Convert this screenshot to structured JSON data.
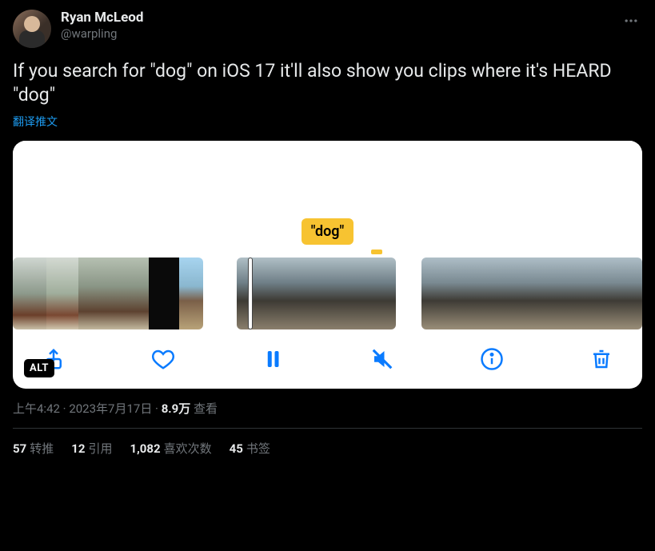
{
  "author": {
    "display_name": "Ryan McLeod",
    "handle": "@warpling"
  },
  "tweet_text": "If you search for \"dog\" on iOS 17 it'll also show you clips where it's HEARD \"dog\"",
  "translate_label": "翻译推文",
  "media": {
    "search_token": "\"dog\"",
    "alt_badge": "ALT",
    "toolbar": {
      "share": "share-icon",
      "like": "heart-icon",
      "pause": "pause-icon",
      "mute": "mute-icon",
      "info": "info-icon",
      "trash": "trash-icon"
    }
  },
  "meta": {
    "time": "上午4:42",
    "date": "2023年7月17日",
    "views_count": "8.9万",
    "views_label": "查看",
    "separator": " · "
  },
  "stats": {
    "retweets": {
      "count": "57",
      "label": "转推"
    },
    "quotes": {
      "count": "12",
      "label": "引用"
    },
    "likes": {
      "count": "1,082",
      "label": "喜欢次数"
    },
    "bookmarks": {
      "count": "45",
      "label": "书签"
    }
  }
}
